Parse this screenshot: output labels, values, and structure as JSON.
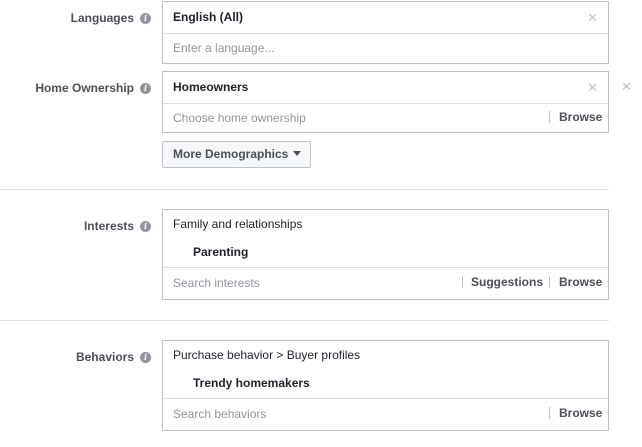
{
  "languages": {
    "label": "Languages",
    "selected": "English (All)",
    "placeholder": "Enter a language..."
  },
  "home_ownership": {
    "label": "Home Ownership",
    "selected": "Homeowners",
    "placeholder": "Choose home ownership",
    "browse": "Browse"
  },
  "more_demographics": {
    "label": "More Demographics"
  },
  "interests": {
    "label": "Interests",
    "category": "Family and relationships",
    "item": "Parenting",
    "placeholder": "Search interests",
    "suggestions": "Suggestions",
    "browse": "Browse"
  },
  "behaviors": {
    "label": "Behaviors",
    "category": "Purchase behavior > Buyer profiles",
    "item": "Trendy homemakers",
    "placeholder": "Search behaviors",
    "browse": "Browse"
  },
  "icons": {
    "info": "info-icon",
    "remove": "close-icon",
    "dropdown": "chevron-down-icon"
  },
  "colors": {
    "border": "#bec2c9",
    "label": "#4b4f56",
    "placeholder": "#90949c",
    "divider": "#dddfe2"
  }
}
